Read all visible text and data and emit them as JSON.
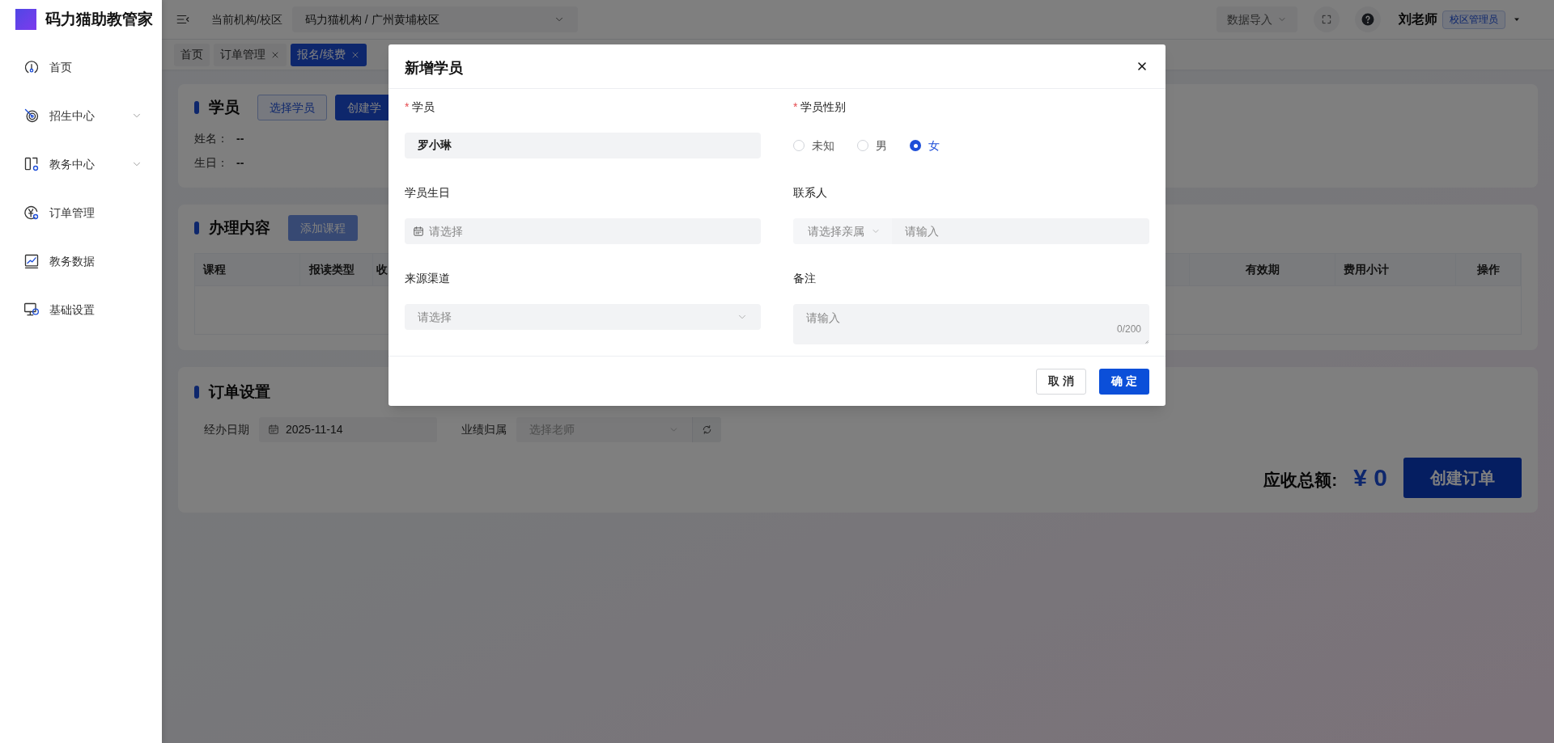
{
  "sidebar": {
    "title": "码力猫助教管家",
    "items": [
      {
        "label": "首页",
        "expandable": false
      },
      {
        "label": "招生中心",
        "expandable": true
      },
      {
        "label": "教务中心",
        "expandable": true
      },
      {
        "label": "订单管理",
        "expandable": false
      },
      {
        "label": "教务数据",
        "expandable": false
      },
      {
        "label": "基础设置",
        "expandable": false
      }
    ]
  },
  "header": {
    "org_label": "当前机构/校区",
    "org_value": "码力猫机构 / 广州黄埔校区",
    "import_button": "数据导入",
    "user_name": "刘老师",
    "user_role": "校区管理员"
  },
  "tabs": [
    {
      "label": "首页",
      "selected": false,
      "closable": false
    },
    {
      "label": "订单管理",
      "selected": false,
      "closable": true
    },
    {
      "label": "报名/续费",
      "selected": true,
      "closable": true
    }
  ],
  "student_card": {
    "title": "学员",
    "buttons": [
      {
        "label": "选择学员",
        "kind": "outline"
      },
      {
        "label": "创建学",
        "kind": "primary"
      }
    ],
    "fields": [
      {
        "label": "姓名：",
        "value": "--"
      },
      {
        "label": "生日：",
        "value": "--"
      }
    ]
  },
  "content_card": {
    "title": "办理内容",
    "add_button": "添加课程",
    "columns": [
      "课程",
      "报读类型",
      "收",
      "有效期",
      "费用小计",
      "操作"
    ]
  },
  "order_card": {
    "title": "订单设置",
    "date_label": "经办日期",
    "date_value": "2025-11-14",
    "owner_label": "业绩归属",
    "owner_placeholder": "选择老师",
    "total_label": "应收总额:",
    "total_value": "¥ 0",
    "create_button": "创建订单"
  },
  "modal": {
    "title": "新增学员",
    "fields": [
      {
        "kind": "text",
        "required_mark": "*",
        "label": "学员",
        "value": "罗小琳"
      },
      {
        "kind": "radio",
        "required_mark": "*",
        "label": "学员性别",
        "options": [
          {
            "label": "未知",
            "selected": false
          },
          {
            "label": "男",
            "selected": false
          },
          {
            "label": "女",
            "selected": true
          }
        ]
      },
      {
        "kind": "date",
        "label": "学员生日",
        "placeholder": "请选择"
      },
      {
        "kind": "contact",
        "label": "联系人",
        "relation_placeholder": "请选择亲属",
        "placeholder": "请输入"
      },
      {
        "kind": "select",
        "label": "来源渠道",
        "placeholder": "请选择"
      },
      {
        "kind": "textarea",
        "label": "备注",
        "placeholder": "请输入",
        "counter": "0/200"
      }
    ],
    "cancel_button": "取 消",
    "ok_button": "确 定"
  }
}
